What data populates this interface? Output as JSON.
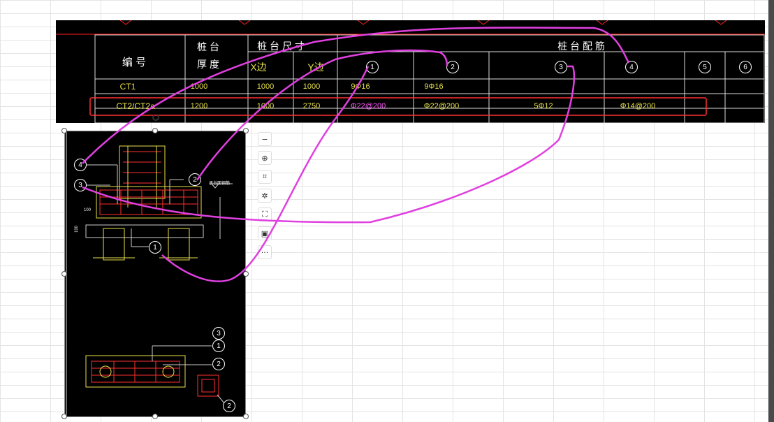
{
  "table": {
    "header_col1": "编  号",
    "header_col2_line1": "桩  台",
    "header_col2_line2": "厚  度",
    "header_size_group": "桩 台 尺 寸",
    "header_x": "X边",
    "header_y": "Y边",
    "header_rebar_group": "桩  台  配  筋",
    "rebar_markers": [
      "1",
      "2",
      "3",
      "4",
      "5",
      "6"
    ],
    "rows": [
      {
        "id": "CT1",
        "thickness": "1000",
        "x": "1000",
        "y": "1000",
        "r1": "9Φ16",
        "r2": "9Φ16",
        "r3": "",
        "r4": ""
      },
      {
        "id": "CT2/CT2a",
        "thickness": "1200",
        "x": "1000",
        "y": "2750",
        "r1": "Φ22@200",
        "r2": "Φ22@200",
        "r3": "5Φ12",
        "r4": "Φ14@200"
      }
    ]
  },
  "section_drawing": {
    "callouts_left": [
      "4",
      "3"
    ],
    "callout_right": "2",
    "callout_bottom": "1",
    "label_section": "承台面钢筋",
    "dim_100": "100",
    "dim_side": "100"
  },
  "plan_drawing": {
    "callouts": [
      "3",
      "1",
      "2",
      "2"
    ]
  },
  "toolbar": {
    "buttons": [
      {
        "name": "collapse",
        "glyph": "−"
      },
      {
        "name": "zoom-in",
        "glyph": "⊕"
      },
      {
        "name": "crop",
        "glyph": "⌗"
      },
      {
        "name": "magic-wand",
        "glyph": "✲"
      },
      {
        "name": "ocr",
        "glyph": "⛶"
      },
      {
        "name": "image-search",
        "glyph": "▣"
      },
      {
        "name": "more",
        "glyph": "···"
      }
    ]
  },
  "colors": {
    "annotation": "#e040e0",
    "highlight_box": "#ff3030",
    "cad_background": "#000000",
    "cad_text": "#ffffff",
    "cad_yellow": "#e8e04a"
  }
}
